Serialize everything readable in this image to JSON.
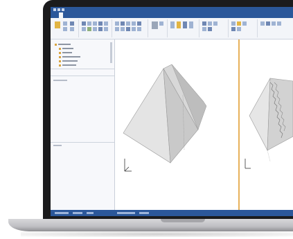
{
  "app": {
    "title": "",
    "tabs": [
      "",
      "",
      "",
      "",
      "",
      "",
      "",
      "",
      ""
    ],
    "active_tab_index": 1
  },
  "ribbon": {
    "groups": [
      "",
      "",
      "",
      "",
      "",
      "",
      "",
      ""
    ]
  },
  "panel": {
    "tree_items": [
      "",
      "",
      "",
      "",
      "",
      ""
    ],
    "tabs": [
      "",
      "",
      ""
    ]
  },
  "viewports": [
    {
      "name": "3d-view-left",
      "model": "pyramid-icon",
      "frame_color": "#e7b15a"
    },
    {
      "name": "3d-view-right",
      "model": "stepped-pyramid-icon"
    }
  ],
  "colors": {
    "ribbon_blue": "#2b579a",
    "active_viewport": "#e7b15a",
    "laptop_bezel": "#1b1b1d"
  }
}
